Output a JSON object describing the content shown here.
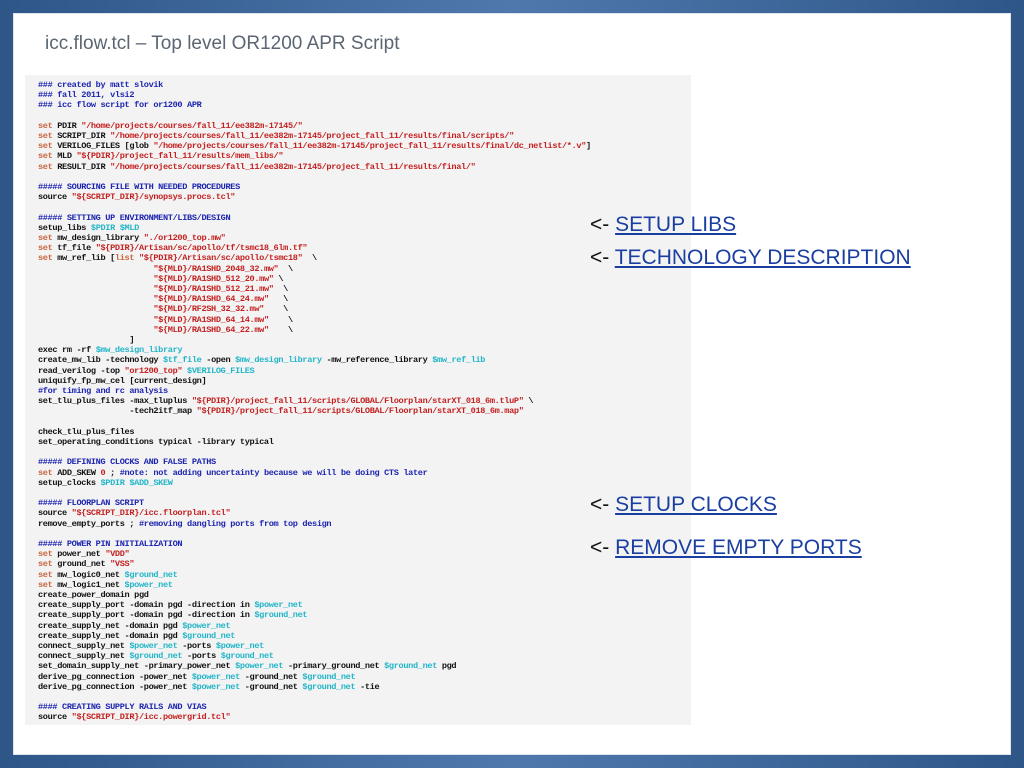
{
  "slide": {
    "title": "icc.flow.tcl – Top level OR1200 APR Script"
  },
  "annotations": [
    {
      "arrow": "<- ",
      "link": "SETUP LIBS"
    },
    {
      "arrow": "<- ",
      "link": "TECHNOLOGY DESCRIPTION"
    },
    {
      "arrow": "<- ",
      "link": "SETUP CLOCKS"
    },
    {
      "arrow": "<- ",
      "link": "REMOVE EMPTY PORTS"
    }
  ],
  "code_lines": [
    [
      [
        "cmt",
        "### created by matt slovik"
      ]
    ],
    [
      [
        "cmt",
        "### fall 2011, vlsi2"
      ]
    ],
    [
      [
        "cmt",
        "### icc flow script for or1200 APR"
      ]
    ],
    [],
    [
      [
        "kw",
        "set"
      ],
      [
        "txt",
        " PDIR "
      ],
      [
        "str",
        "\"/home/projects/courses/fall_11/ee382m-17145/\""
      ]
    ],
    [
      [
        "kw",
        "set"
      ],
      [
        "txt",
        " SCRIPT_DIR "
      ],
      [
        "str",
        "\"/home/projects/courses/fall_11/ee382m-17145/project_fall_11/results/final/scripts/\""
      ]
    ],
    [
      [
        "kw",
        "set"
      ],
      [
        "txt",
        " VERILOG_FILES [glob "
      ],
      [
        "str",
        "\"/home/projects/courses/fall_11/ee382m-17145/project_fall_11/results/final/dc_netlist/*.v\""
      ],
      [
        "txt",
        "]"
      ]
    ],
    [
      [
        "kw",
        "set"
      ],
      [
        "txt",
        " MLD "
      ],
      [
        "str",
        "\"${PDIR}/project_fall_11/results/mem_libs/\""
      ]
    ],
    [
      [
        "kw",
        "set"
      ],
      [
        "txt",
        " RESULT_DIR "
      ],
      [
        "str",
        "\"/home/projects/courses/fall_11/ee382m-17145/project_fall_11/results/final/\""
      ]
    ],
    [],
    [
      [
        "cmt",
        "##### SOURCING FILE WITH NEEDED PROCEDURES"
      ]
    ],
    [
      [
        "txt",
        "source "
      ],
      [
        "str",
        "\"${SCRIPT_DIR}/synopsys.procs.tcl\""
      ]
    ],
    [],
    [
      [
        "cmt",
        "##### SETTING UP ENVIRONMENT/LIBS/DESIGN"
      ]
    ],
    [
      [
        "txt",
        "setup_libs "
      ],
      [
        "var",
        "$PDIR $MLD"
      ]
    ],
    [
      [
        "kw",
        "set"
      ],
      [
        "txt",
        " mw_design_library "
      ],
      [
        "str",
        "\"./or1200_top.mw\""
      ]
    ],
    [
      [
        "kw",
        "set"
      ],
      [
        "txt",
        " tf_file "
      ],
      [
        "str",
        "\"${PDIR}/Artisan/sc/apollo/tf/tsmc18_6lm.tf\""
      ]
    ],
    [
      [
        "kw",
        "set"
      ],
      [
        "txt",
        " mw_ref_lib ["
      ],
      [
        "kw",
        "list"
      ],
      [
        "txt",
        " "
      ],
      [
        "str",
        "\"${PDIR}/Artisan/sc/apollo/tsmc18\""
      ],
      [
        "txt",
        "  \\"
      ]
    ],
    [
      [
        "txt",
        "                        "
      ],
      [
        "str",
        "\"${MLD}/RA1SHD_2048_32.mw\""
      ],
      [
        "txt",
        "  \\"
      ]
    ],
    [
      [
        "txt",
        "                        "
      ],
      [
        "str",
        "\"${MLD}/RA1SHD_512_20.mw\""
      ],
      [
        "txt",
        " \\"
      ]
    ],
    [
      [
        "txt",
        "                        "
      ],
      [
        "str",
        "\"${MLD}/RA1SHD_512_21.mw\""
      ],
      [
        "txt",
        "  \\"
      ]
    ],
    [
      [
        "txt",
        "                        "
      ],
      [
        "str",
        "\"${MLD}/RA1SHD_64_24.mw\""
      ],
      [
        "txt",
        "   \\"
      ]
    ],
    [
      [
        "txt",
        "                        "
      ],
      [
        "str",
        "\"${MLD}/RF2SH_32_32.mw\""
      ],
      [
        "txt",
        "    \\"
      ]
    ],
    [
      [
        "txt",
        "                        "
      ],
      [
        "str",
        "\"${MLD}/RA1SHD_64_14.mw\""
      ],
      [
        "txt",
        "    \\"
      ]
    ],
    [
      [
        "txt",
        "                        "
      ],
      [
        "str",
        "\"${MLD}/RA1SHD_64_22.mw\""
      ],
      [
        "txt",
        "    \\"
      ]
    ],
    [
      [
        "txt",
        "                   ]"
      ]
    ],
    [
      [
        "txt",
        "exec rm -rf "
      ],
      [
        "var",
        "$mw_design_library"
      ]
    ],
    [
      [
        "txt",
        "create_mw_lib -technology "
      ],
      [
        "var",
        "$tf_file"
      ],
      [
        "txt",
        " -open "
      ],
      [
        "var",
        "$mw_design_library"
      ],
      [
        "txt",
        " -mw_reference_library "
      ],
      [
        "var",
        "$mw_ref_lib"
      ]
    ],
    [
      [
        "txt",
        "read_verilog -top "
      ],
      [
        "str",
        "\"or1200_top\""
      ],
      [
        "txt",
        " "
      ],
      [
        "var",
        "$VERILOG_FILES"
      ]
    ],
    [
      [
        "txt",
        "uniquify_fp_mw_cel [current_design]"
      ]
    ],
    [
      [
        "cmt",
        "#for timing and rc analysis"
      ]
    ],
    [
      [
        "txt",
        "set_tlu_plus_files -max_tluplus "
      ],
      [
        "str",
        "\"${PDIR}/project_fall_11/scripts/GLOBAL/Floorplan/starXT_018_6m.tluP\""
      ],
      [
        "txt",
        " \\"
      ]
    ],
    [
      [
        "txt",
        "                   -tech2itf_map "
      ],
      [
        "str",
        "\"${PDIR}/project_fall_11/scripts/GLOBAL/Floorplan/starXT_018_6m.map\""
      ]
    ],
    [],
    [
      [
        "txt",
        "check_tlu_plus_files"
      ]
    ],
    [
      [
        "txt",
        "set_operating_conditions typical -library typical"
      ]
    ],
    [],
    [
      [
        "cmt",
        "##### DEFINING CLOCKS AND FALSE PATHS"
      ]
    ],
    [
      [
        "kw",
        "set"
      ],
      [
        "txt",
        " ADD_SKEW "
      ],
      [
        "str",
        "0"
      ],
      [
        "txt",
        " ; "
      ],
      [
        "cmt",
        "#note: not adding uncertainty because we will be doing CTS later"
      ]
    ],
    [
      [
        "txt",
        "setup_clocks "
      ],
      [
        "var",
        "$PDIR $ADD_SKEW"
      ]
    ],
    [],
    [
      [
        "cmt",
        "##### FLOORPLAN SCRIPT"
      ]
    ],
    [
      [
        "txt",
        "source "
      ],
      [
        "str",
        "\"${SCRIPT_DIR}/icc.floorplan.tcl\""
      ]
    ],
    [
      [
        "txt",
        "remove_empty_ports ; "
      ],
      [
        "cmt",
        "#removing dangling ports from top design"
      ]
    ],
    [],
    [
      [
        "cmt",
        "##### POWER PIN INITIALIZATION"
      ]
    ],
    [
      [
        "kw",
        "set"
      ],
      [
        "txt",
        " power_net "
      ],
      [
        "str",
        "\"VDD\""
      ]
    ],
    [
      [
        "kw",
        "set"
      ],
      [
        "txt",
        " ground_net "
      ],
      [
        "str",
        "\"VSS\""
      ]
    ],
    [
      [
        "kw",
        "set"
      ],
      [
        "txt",
        " mw_logic0_net "
      ],
      [
        "var",
        "$ground_net"
      ]
    ],
    [
      [
        "kw",
        "set"
      ],
      [
        "txt",
        " mw_logic1_net "
      ],
      [
        "var",
        "$power_net"
      ]
    ],
    [
      [
        "txt",
        "create_power_domain pgd"
      ]
    ],
    [
      [
        "txt",
        "create_supply_port -domain pgd -direction in "
      ],
      [
        "var",
        "$power_net"
      ]
    ],
    [
      [
        "txt",
        "create_supply_port -domain pgd -direction in "
      ],
      [
        "var",
        "$ground_net"
      ]
    ],
    [
      [
        "txt",
        "create_supply_net -domain pgd "
      ],
      [
        "var",
        "$power_net"
      ]
    ],
    [
      [
        "txt",
        "create_supply_net -domain pgd "
      ],
      [
        "var",
        "$ground_net"
      ]
    ],
    [
      [
        "txt",
        "connect_supply_net "
      ],
      [
        "var",
        "$power_net"
      ],
      [
        "txt",
        " -ports "
      ],
      [
        "var",
        "$power_net"
      ]
    ],
    [
      [
        "txt",
        "connect_supply_net "
      ],
      [
        "var",
        "$ground_net"
      ],
      [
        "txt",
        " -ports "
      ],
      [
        "var",
        "$ground_net"
      ]
    ],
    [
      [
        "txt",
        "set_domain_supply_net -primary_power_net "
      ],
      [
        "var",
        "$power_net"
      ],
      [
        "txt",
        " -primary_ground_net "
      ],
      [
        "var",
        "$ground_net"
      ],
      [
        "txt",
        " pgd"
      ]
    ],
    [
      [
        "txt",
        "derive_pg_connection -power_net "
      ],
      [
        "var",
        "$power_net"
      ],
      [
        "txt",
        " -ground_net "
      ],
      [
        "var",
        "$ground_net"
      ]
    ],
    [
      [
        "txt",
        "derive_pg_connection -power_net "
      ],
      [
        "var",
        "$power_net"
      ],
      [
        "txt",
        " -ground_net "
      ],
      [
        "var",
        "$ground_net"
      ],
      [
        "txt",
        " -tie"
      ]
    ],
    [],
    [
      [
        "cmt",
        "#### CREATING SUPPLY RAILS AND VIAS"
      ]
    ],
    [
      [
        "txt",
        "source "
      ],
      [
        "str",
        "\"${SCRIPT_DIR}/icc.powergrid.tcl\""
      ]
    ]
  ],
  "colors": {
    "keyword": "#c9653e",
    "string": "#c42020",
    "variable": "#22b5c8",
    "comment": "#1c24b0",
    "link": "#1a3fa0",
    "frame": "#3b669c"
  }
}
